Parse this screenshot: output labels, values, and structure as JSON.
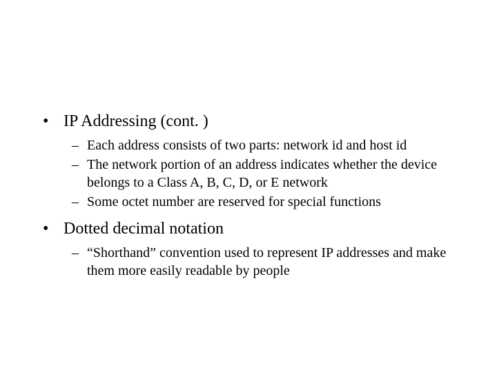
{
  "slide": {
    "bullets": [
      {
        "label": "IP Addressing (cont. )",
        "subs": [
          "Each address consists of two parts: network id and host id",
          "The network portion of an address indicates whether the device belongs to a Class A, B, C, D, or E network",
          "Some octet number are reserved for special functions"
        ]
      },
      {
        "label": "Dotted decimal notation",
        "subs": [
          "“Shorthand” convention used to represent IP addresses and make them more easily readable by people"
        ]
      }
    ]
  },
  "glyphs": {
    "bullet": "•",
    "dash": "–"
  }
}
